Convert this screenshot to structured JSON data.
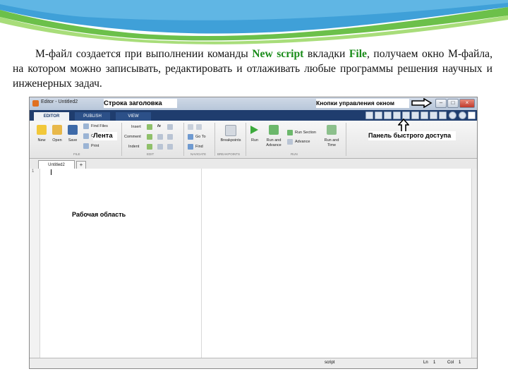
{
  "paragraph": {
    "part1": "М-файл создается при выполнении команды ",
    "cmd": "New script",
    "part2": " вкладки ",
    "tab": "File",
    "part3": ", получаем окно М-файла, на котором можно записывать, редактировать и отлаживать любые программы решения научных и инженерных задач."
  },
  "window": {
    "title": "Editor - Untitled2",
    "tabs": [
      "EDITOR",
      "PUBLISH",
      "VIEW"
    ],
    "minimize": "–",
    "maximize": "□",
    "close": "×"
  },
  "ribbon": {
    "file": {
      "new": "New",
      "open": "Open",
      "save": "Save",
      "find_files": "Find Files",
      "compare": "Co",
      "print": "Print",
      "group": "FILE"
    },
    "edit": {
      "insert": "Insert",
      "comment": "Comment",
      "indent": "Indent",
      "fx": "fx",
      "group": "EDIT"
    },
    "navigate": {
      "goto": "Go To",
      "find": "Find",
      "group": "NAVIGATE"
    },
    "breakpoints": {
      "label": "Breakpoints",
      "group": "BREAKPOINTS"
    },
    "run": {
      "run": "Run",
      "run_and_advance": "Run and Advance",
      "run_section": "Run Section",
      "advance": "Advance",
      "run_and_time": "Run and Time",
      "group": "RUN"
    }
  },
  "document": {
    "tab": "Untitled2",
    "add_tab": "+",
    "line_number": "1"
  },
  "status": {
    "mode": "script",
    "ln_label": "Ln",
    "ln_value": "1",
    "col_label": "Col",
    "col_value": "1"
  },
  "annotations": {
    "title_bar": "Строка заголовка",
    "window_buttons": "Кнопки управления окном",
    "ribbon": "Лента",
    "quick_access": "Панель быстрого доступа",
    "workspace": "Рабочая область"
  },
  "colors": {
    "highlight": "#1a8c1a",
    "tabbar": "#1f3d6e",
    "banner_green": "#6cc04a",
    "banner_blue": "#3fa0d8"
  }
}
